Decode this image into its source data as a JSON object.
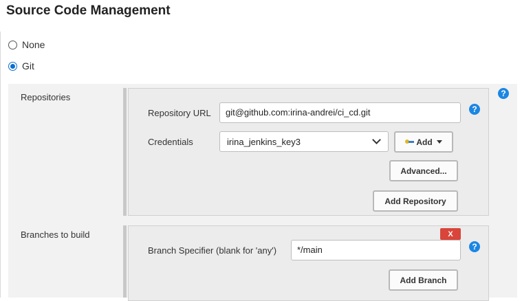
{
  "section": {
    "title": "Source Code Management"
  },
  "scm_options": [
    {
      "label": "None",
      "selected": false
    },
    {
      "label": "Git",
      "selected": true
    }
  ],
  "repositories": {
    "label": "Repositories",
    "url_label": "Repository URL",
    "url_value": "git@github.com:irina-andrei/ci_cd.git",
    "credentials_label": "Credentials",
    "credentials_value": "irina_jenkins_key3",
    "add_label": "Add",
    "advanced_label": "Advanced...",
    "add_repository_label": "Add Repository"
  },
  "branches": {
    "label": "Branches to build",
    "specifier_label": "Branch Specifier (blank for 'any')",
    "specifier_value": "*/main",
    "delete_label": "X",
    "add_branch_label": "Add Branch"
  },
  "help": {
    "glyph": "?"
  },
  "colors": {
    "accent": "#1b86e3",
    "radio_checked": "#0b6ed1",
    "delete": "#d9453a"
  },
  "icons": {
    "help": "help-icon",
    "credentials_key": "key-icon",
    "dropdown": "chevron-down-icon"
  }
}
